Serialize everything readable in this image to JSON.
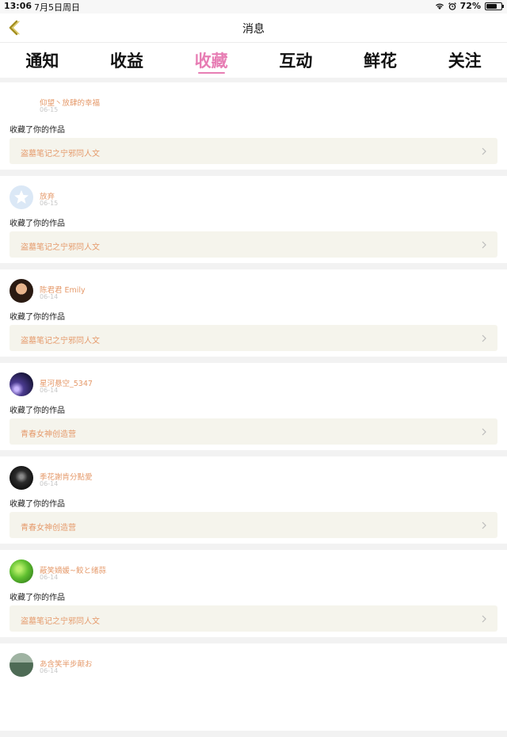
{
  "status_bar": {
    "time": "13:06",
    "date": "7月5日周日",
    "battery": "72%"
  },
  "navbar": {
    "title": "消息"
  },
  "tabs": [
    {
      "label": "通知",
      "active": false
    },
    {
      "label": "收益",
      "active": false
    },
    {
      "label": "收藏",
      "active": true
    },
    {
      "label": "互动",
      "active": false
    },
    {
      "label": "鲜花",
      "active": false
    },
    {
      "label": "关注",
      "active": false
    }
  ],
  "notifications": [
    {
      "user": "仰望丶放肆的幸福",
      "date": "06-15",
      "action": "收藏了你的作品",
      "work": "盗墓笔记之宁邪同人文",
      "avatar": "none"
    },
    {
      "user": "放弃",
      "date": "06-15",
      "action": "收藏了你的作品",
      "work": "盗墓笔记之宁邪同人文",
      "avatar": "default"
    },
    {
      "user": "陈君君 Emily",
      "date": "06-14",
      "action": "收藏了你的作品",
      "work": "盗墓笔记之宁邪同人文",
      "avatar": "portrait"
    },
    {
      "user": "星河悬空_5347",
      "date": "06-14",
      "action": "收藏了你的作品",
      "work": "青春女神创造营",
      "avatar": "galaxy"
    },
    {
      "user": "季花謝肯分點愛",
      "date": "06-14",
      "action": "收藏了你的作品",
      "work": "青春女神创造营",
      "avatar": "dark"
    },
    {
      "user": "蔽笑嫡媛~鲛と绪蒜",
      "date": "06-14",
      "action": "收藏了你的作品",
      "work": "盗墓笔记之宁邪同人文",
      "avatar": "green"
    },
    {
      "user": "あ含笑半步颠お",
      "date": "06-14",
      "action": "",
      "work": "",
      "avatar": "building"
    }
  ],
  "colors": {
    "accent": "#e77eb4",
    "link": "#e59a6b",
    "card_link_bg": "#f5f4ec"
  }
}
